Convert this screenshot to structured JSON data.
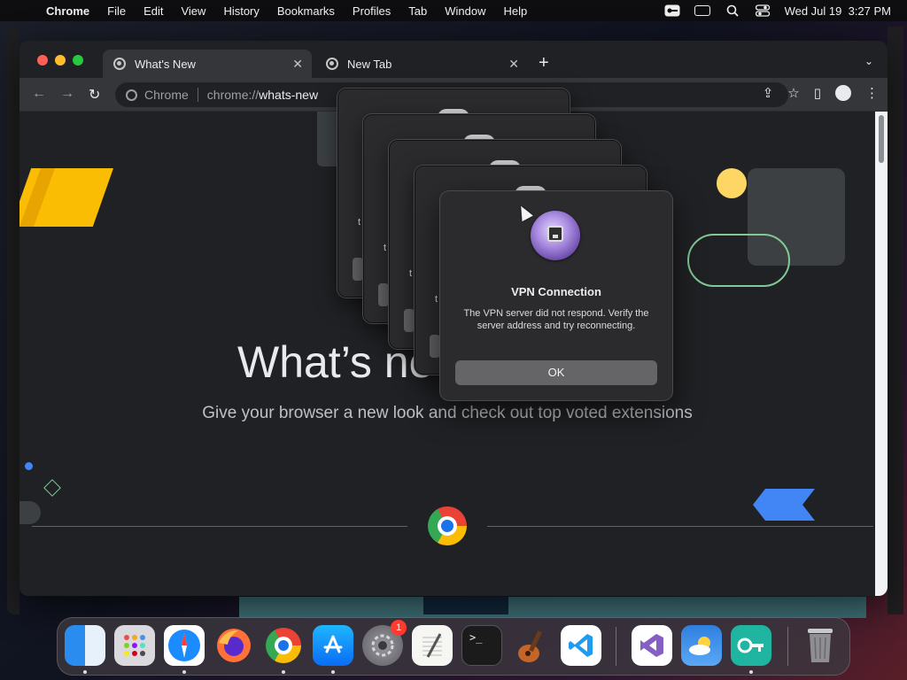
{
  "menubar": {
    "apple_icon": "apple-logo",
    "app_name": "Chrome",
    "items": [
      "File",
      "Edit",
      "View",
      "History",
      "Bookmarks",
      "Profiles",
      "Tab",
      "Window",
      "Help"
    ],
    "datetime": "Wed Jul 19  3:27 PM",
    "status_icons": [
      "vpn-key-icon",
      "screen-mirroring-icon",
      "search-icon",
      "control-center-icon"
    ]
  },
  "browser": {
    "tabs": [
      {
        "title": "What's New",
        "active": true
      },
      {
        "title": "New Tab",
        "active": false
      }
    ],
    "new_tab_symbol": "+",
    "tab_search_symbol": "⌄",
    "omnibox": {
      "site_label": "Chrome",
      "url_scheme": "chrome://",
      "url_path": "whats-new"
    }
  },
  "page": {
    "title": "What’s new",
    "subtitle": "Give your browser a new look and check out top voted extensions"
  },
  "ghost_dialogs": [
    {
      "partial_text": "t"
    },
    {
      "partial_text": "t"
    },
    {
      "partial_text": "t"
    },
    {
      "partial_text": "t"
    }
  ],
  "dialog": {
    "title": "VPN Connection",
    "message": "The VPN server did not respond. Verify the server address and try reconnecting.",
    "ok_label": "OK",
    "icon": "network-vpn-icon"
  },
  "dock": {
    "apps": [
      {
        "name": "Finder",
        "running": true
      },
      {
        "name": "Launchpad",
        "running": false
      },
      {
        "name": "Safari",
        "running": true
      },
      {
        "name": "Firefox",
        "running": false
      },
      {
        "name": "Chrome",
        "running": true
      },
      {
        "name": "App Store",
        "running": true
      },
      {
        "name": "System Settings",
        "running": false,
        "badge": "1"
      },
      {
        "name": "TextEdit",
        "running": false
      },
      {
        "name": "Terminal",
        "running": false
      },
      {
        "name": "GarageBand",
        "running": false
      },
      {
        "name": "Visual Studio Code",
        "running": false
      },
      {
        "name": "Visual Studio",
        "running": false
      },
      {
        "name": "Weather",
        "running": false
      },
      {
        "name": "VPN Client",
        "running": true
      },
      {
        "name": "Trash",
        "running": false
      }
    ]
  },
  "colors": {
    "dialog_bg": "#2b2b2d",
    "button_bg": "#656568",
    "chrome_bg": "#202124",
    "accent_blue": "#4285f4",
    "accent_yellow": "#fbbc04",
    "accent_green": "#81c995"
  }
}
